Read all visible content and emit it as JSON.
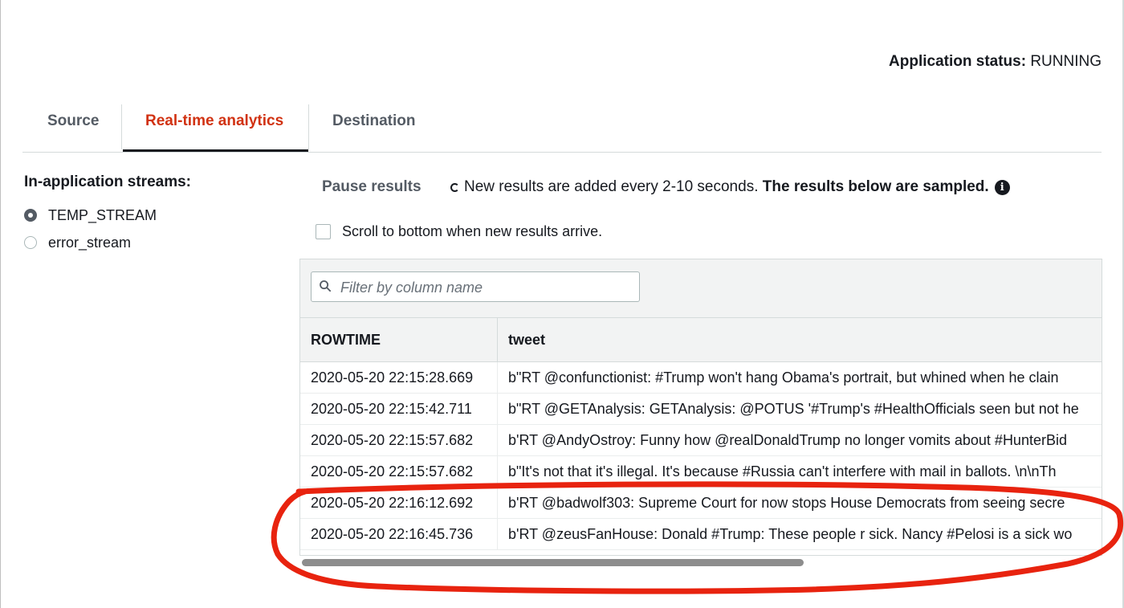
{
  "status": {
    "label": "Application status:",
    "value": "RUNNING"
  },
  "tabs": [
    {
      "label": "Source"
    },
    {
      "label": "Real-time analytics"
    },
    {
      "label": "Destination"
    }
  ],
  "streams": {
    "title": "In-application streams:",
    "items": [
      {
        "label": "TEMP_STREAM",
        "selected": true
      },
      {
        "label": "error_stream",
        "selected": false
      }
    ]
  },
  "results": {
    "pause_label": "Pause results",
    "notice": "New results are added every 2-10 seconds.",
    "notice_bold": "The results below are sampled.",
    "info_icon": "i",
    "scroll_label": "Scroll to bottom when new results arrive."
  },
  "filter": {
    "placeholder": "Filter by column name"
  },
  "table": {
    "columns": [
      "ROWTIME",
      "tweet"
    ],
    "rows": [
      [
        "2020-05-20 22:15:28.669",
        "b\"RT @confunctionist: #Trump won't hang Obama's portrait, but whined when he clain"
      ],
      [
        "2020-05-20 22:15:42.711",
        "b\"RT @GETAnalysis: GETAnalysis: @POTUS '#Trump's #HealthOfficials seen but not he"
      ],
      [
        "2020-05-20 22:15:57.682",
        "b'RT @AndyOstroy: Funny how @realDonaldTrump no longer vomits about #HunterBid"
      ],
      [
        "2020-05-20 22:15:57.682",
        "b\"It's not that it's illegal. It's because #Russia can't interfere with mail in ballots. \\n\\nTh"
      ],
      [
        "2020-05-20 22:16:12.692",
        "b'RT @badwolf303: Supreme Court for now stops House Democrats from seeing secre"
      ],
      [
        "2020-05-20 22:16:45.736",
        "b'RT @zeusFanHouse: Donald #Trump: These people r sick. Nancy #Pelosi is a sick wo"
      ]
    ]
  },
  "colors": {
    "active_tab": "#d13212",
    "annotation": "#e8230f"
  }
}
